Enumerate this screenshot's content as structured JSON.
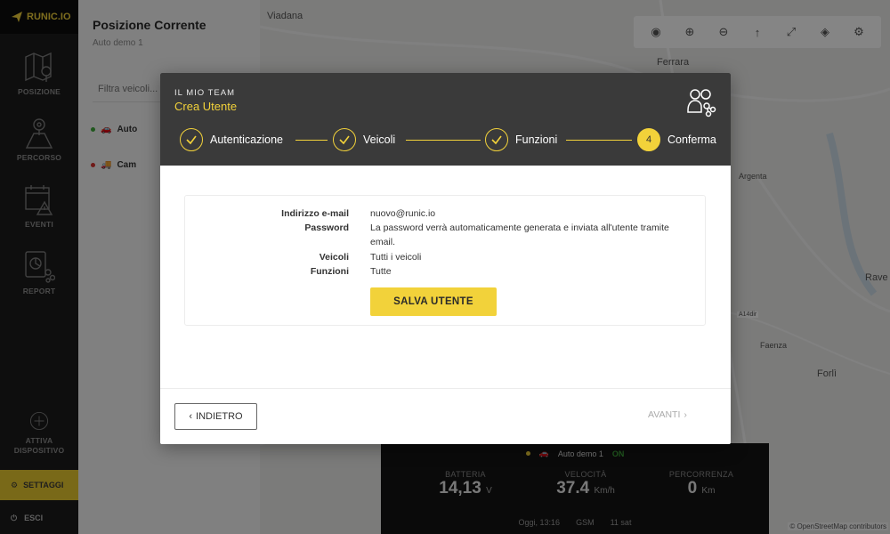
{
  "brand": {
    "name": "RUNIC.IO"
  },
  "sidebar": {
    "items": [
      {
        "label": "POSIZIONE"
      },
      {
        "label": "PERCORSO"
      },
      {
        "label": "EVENTI"
      },
      {
        "label": "REPORT"
      }
    ],
    "activate": {
      "line1": "ATTIVA",
      "line2": "DISPOSITIVO"
    },
    "settings": "SETTAGGI",
    "exit": "ESCI"
  },
  "panel": {
    "title": "Posizione Corrente",
    "subtitle": "Auto demo 1",
    "filter_placeholder": "Filtra veicoli...",
    "vehicles": [
      {
        "name": "Auto",
        "status_color": "#3ea83a"
      },
      {
        "name": "Cam",
        "status_color": "#d6322e"
      }
    ]
  },
  "map": {
    "labels": [
      "Viadana",
      "Ferrara",
      "Argenta",
      "Faenza",
      "Forlì",
      "Rave",
      "A14dir"
    ],
    "attribution": "© OpenStreetMap contributors"
  },
  "info_panel": {
    "vehicle": "Auto demo 1",
    "state": "ON",
    "metrics": [
      {
        "label": "BATTERIA",
        "value": "14,13",
        "unit": "V"
      },
      {
        "label": "VELOCITÀ",
        "value": "37.4",
        "unit": "Km/h"
      },
      {
        "label": "PERCORRENZA",
        "value": "0",
        "unit": "Km"
      }
    ],
    "time": "Oggi, 13:16",
    "gsm": "GSM",
    "sat": "11 sat"
  },
  "modal": {
    "eyebrow": "IL MIO TEAM",
    "title": "Crea Utente",
    "steps": [
      {
        "label": "Autenticazione",
        "done": true
      },
      {
        "label": "Veicoli",
        "done": true
      },
      {
        "label": "Funzioni",
        "done": true
      },
      {
        "label": "Conferma",
        "number": "4",
        "done": false
      }
    ],
    "summary": {
      "email_label": "Indirizzo e-mail",
      "email_value": "nuovo@runic.io",
      "password_label": "Password",
      "password_value": "La password verrà automaticamente generata e inviata all'utente tramite email.",
      "vehicles_label": "Veicoli",
      "vehicles_value": "Tutti i veicoli",
      "functions_label": "Funzioni",
      "functions_value": "Tutte"
    },
    "save_label": "SALVA UTENTE",
    "back_label": "INDIETRO",
    "next_label": "AVANTI"
  },
  "colors": {
    "accent": "#f2d23a",
    "header_bg": "#3a3a3a",
    "sidebar_bg": "#1b1b1b"
  }
}
